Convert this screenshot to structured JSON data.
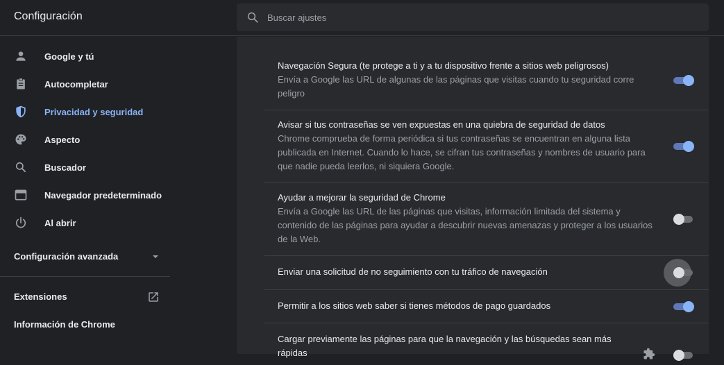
{
  "header": {
    "title": "Configuración",
    "search_placeholder": "Buscar ajustes"
  },
  "sidebar": {
    "items": [
      {
        "label": "Google y tú",
        "icon": "person-icon",
        "active": false
      },
      {
        "label": "Autocompletar",
        "icon": "clipboard-icon",
        "active": false
      },
      {
        "label": "Privacidad y seguridad",
        "icon": "shield-icon",
        "active": true
      },
      {
        "label": "Aspecto",
        "icon": "palette-icon",
        "active": false
      },
      {
        "label": "Buscador",
        "icon": "search-icon",
        "active": false
      },
      {
        "label": "Navegador predeterminado",
        "icon": "browser-icon",
        "active": false
      },
      {
        "label": "Al abrir",
        "icon": "power-icon",
        "active": false
      }
    ],
    "advanced_label": "Configuración avanzada",
    "extensions_label": "Extensiones",
    "about_label": "Información de Chrome"
  },
  "settings": [
    {
      "title": "Navegación Segura (te protege a ti y a tu dispositivo frente a sitios web peligrosos)",
      "description": "Envía a Google las URL de algunas de las páginas que visitas cuando tu seguridad corre peligro",
      "enabled": true
    },
    {
      "title": "Avisar si tus contraseñas se ven expuestas en una quiebra de seguridad de datos",
      "description": "Chrome comprueba de forma periódica si tus contraseñas se encuentran en alguna lista publicada en Internet. Cuando lo hace, se cifran tus contraseñas y nombres de usuario para que nadie pueda leerlos, ni siquiera Google.",
      "enabled": true
    },
    {
      "title": "Ayudar a mejorar la seguridad de Chrome",
      "description": "Envía a Google las URL de las páginas que visitas, información limitada del sistema y contenido de las páginas para ayudar a descubrir nuevas amenazas y proteger a los usuarios de la Web.",
      "enabled": false
    },
    {
      "title": "Enviar una solicitud de no seguimiento con tu tráfico de navegación",
      "description": "",
      "enabled": false
    },
    {
      "title": "Permitir a los sitios web saber si tienes métodos de pago guardados",
      "description": "",
      "enabled": true
    },
    {
      "title": "Cargar previamente las páginas para que la navegación y las búsquedas sean más rápidas",
      "description": "",
      "enabled": false
    }
  ],
  "colors": {
    "accent": "#8ab4f8",
    "background": "#202124",
    "card": "#292a2d"
  }
}
